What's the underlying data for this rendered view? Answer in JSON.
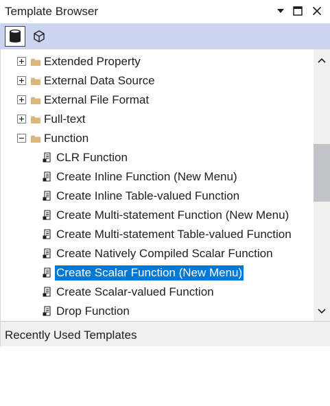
{
  "panel": {
    "title": "Template Browser"
  },
  "toolbar": {
    "buttons": [
      {
        "icon": "database-icon",
        "selected": true
      },
      {
        "icon": "cube-icon",
        "selected": false
      }
    ]
  },
  "tree": {
    "items": [
      {
        "label": "Extended Property",
        "type": "folder",
        "expander": "plus"
      },
      {
        "label": "External Data Source",
        "type": "folder",
        "expander": "plus"
      },
      {
        "label": "External File Format",
        "type": "folder",
        "expander": "plus"
      },
      {
        "label": "Full-text",
        "type": "folder",
        "expander": "plus"
      },
      {
        "label": "Function",
        "type": "folder",
        "expander": "minus"
      },
      {
        "label": "CLR Function",
        "type": "template"
      },
      {
        "label": "Create Inline Function (New Menu)",
        "type": "template"
      },
      {
        "label": "Create Inline Table-valued Function",
        "type": "template"
      },
      {
        "label": "Create Multi-statement Function (New Menu)",
        "type": "template"
      },
      {
        "label": "Create Multi-statement Table-valued Function",
        "type": "template"
      },
      {
        "label": "Create Natively Compiled Scalar Function",
        "type": "template"
      },
      {
        "label": "Create Scalar Function (New Menu)",
        "type": "template",
        "selected": true
      },
      {
        "label": "Create Scalar-valued Function",
        "type": "template"
      },
      {
        "label": "Drop Function",
        "type": "template"
      }
    ]
  },
  "footer": {
    "label": "Recently Used Templates"
  },
  "colors": {
    "toolbar_bg": "#ccd5f0",
    "selection": "#0078d7",
    "folder": "#dcb67a",
    "scroll_thumb": "#c2c3c9"
  }
}
